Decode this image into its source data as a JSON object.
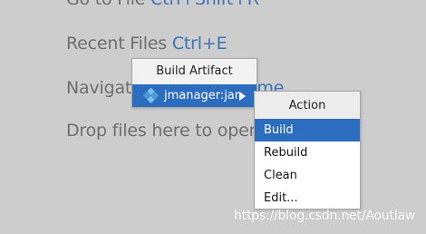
{
  "welcome_hints": [
    {
      "text": "Go to File ",
      "shortcut": "Ctrl+Shift+R"
    },
    {
      "text": "Recent Files ",
      "shortcut": "Ctrl+E"
    },
    {
      "text": "Navigation Bar ",
      "shortcut": "Alt+Home"
    },
    {
      "text": "Drop files here to open",
      "shortcut": ""
    }
  ],
  "build_artifact_popup": {
    "title": "Build Artifact",
    "selected_item": {
      "label": "jmanager:jar",
      "icon": "artifact-icon"
    }
  },
  "action_menu": {
    "title": "Action",
    "items": [
      "Build",
      "Rebuild",
      "Clean",
      "Edit..."
    ],
    "selected": "Build"
  },
  "watermark": "https://blog.csdn.net/Aoutlaw",
  "colors": {
    "background": "#cdcdcd",
    "hint_text": "#6e6e6e",
    "shortcut_text": "#3d73b8",
    "selection": "#2d6dbf",
    "artifact_icon": "#5fa8dc"
  }
}
